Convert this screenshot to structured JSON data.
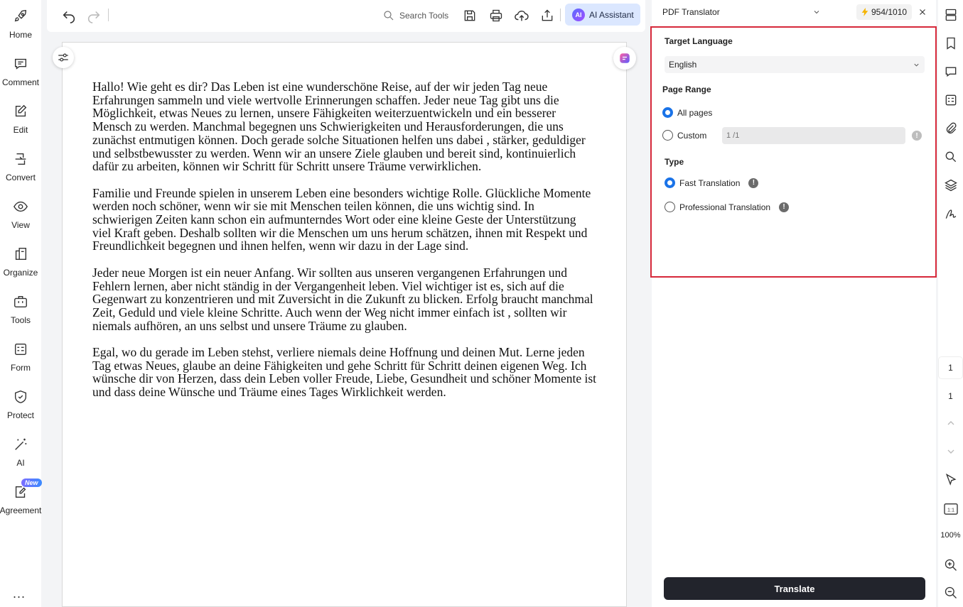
{
  "sidebar": {
    "items": [
      {
        "label": "Home",
        "icon": "rocket-icon"
      },
      {
        "label": "Comment",
        "icon": "comment-icon"
      },
      {
        "label": "Edit",
        "icon": "edit-icon"
      },
      {
        "label": "Convert",
        "icon": "convert-icon"
      },
      {
        "label": "View",
        "icon": "eye-icon"
      },
      {
        "label": "Organize",
        "icon": "organize-icon"
      },
      {
        "label": "Tools",
        "icon": "toolbox-icon"
      },
      {
        "label": "Form",
        "icon": "form-icon"
      },
      {
        "label": "Protect",
        "icon": "shield-icon"
      },
      {
        "label": "AI",
        "icon": "magic-wand-icon"
      },
      {
        "label": "Agreement",
        "icon": "agreement-icon",
        "badge": "New"
      }
    ],
    "more": "..."
  },
  "toolbar": {
    "search_label": "Search Tools",
    "ai_assistant_label": "AI Assistant",
    "ai_logo": "AI"
  },
  "document": {
    "paragraphs": [
      "Hallo! Wie geht es dir? Das Leben ist eine wunderschöne Reise, auf der wir jeden Tag neue Erfahrungen sammeln und viele wertvolle Erinnerungen schaffen. Jeder neue Tag gibt uns die Möglichkeit, etwas Neues zu lernen, unsere Fähigkeiten weiterzuentwickeln und ein besserer Mensch zu werden. Manchmal begegnen uns Schwierigkeiten und Herausforderungen, die uns zunächst entmutigen können. Doch gerade solche Situationen helfen uns dabei , stärker, geduldiger und selbstbewusster zu werden. Wenn wir an unsere Ziele glauben und bereit sind, kontinuierlich dafür zu arbeiten, können wir Schritt für Schritt unsere Träume verwirklichen.",
      "Familie und Freunde spielen in unserem Leben eine besonders wichtige Rolle. Glückliche Momente werden noch schöner, wenn wir sie mit Menschen teilen können, die uns wichtig sind. In schwierigen Zeiten kann schon ein aufmunterndes Wort oder eine kleine Geste der Unterstützung viel Kraft geben. Deshalb sollten wir die Menschen um uns herum schätzen, ihnen mit Respekt und Freundlichkeit begegnen und ihnen helfen, wenn wir dazu in der Lage sind.",
      "Jeder neue Morgen ist ein neuer Anfang. Wir sollten aus unseren vergangenen Erfahrungen und Fehlern lernen, aber nicht ständig in der Vergangenheit leben. Viel wichtiger ist es, sich auf die Gegenwart zu konzentrieren und mit Zuversicht in die Zukunft zu blicken. Erfolg braucht manchmal Zeit, Geduld und viele kleine Schritte. Auch wenn der Weg nicht immer einfach ist , sollten wir niemals aufhören, an uns selbst und unsere Träume zu glauben.",
      "Egal, wo du gerade im Leben stehst, verliere niemals deine Hoffnung und deinen Mut. Lerne jeden Tag etwas Neues, glaube an deine Fähigkeiten und gehe Schritt für Schritt deinen eigenen Weg. Ich wünsche dir von Herzen, dass dein Leben voller Freude, Liebe, Gesundheit und schöner Momente ist und dass deine Wünsche und Träume eines Tages Wirklichkeit werden."
    ]
  },
  "panel": {
    "tool_name": "PDF Translator",
    "credits": "954/1010",
    "target_language_title": "Target Language",
    "target_language_value": "English",
    "page_range_title": "Page Range",
    "all_pages_label": "All pages",
    "custom_label": "Custom",
    "custom_placeholder": "1 /1",
    "type_title": "Type",
    "fast_label": "Fast Translation",
    "professional_label": "Professional Translation",
    "translate_label": "Translate",
    "page_range_selected": "All pages",
    "type_selected": "Fast Translation"
  },
  "right_rail": {
    "current_page": "1",
    "total_pages": "1",
    "fit_label": "1:1",
    "zoom": "100%"
  },
  "colors": {
    "accent": "#1a73e8",
    "highlight_border": "#d6283a",
    "translate_button": "#22242c",
    "ai_button_bg": "#dbe7ff"
  }
}
